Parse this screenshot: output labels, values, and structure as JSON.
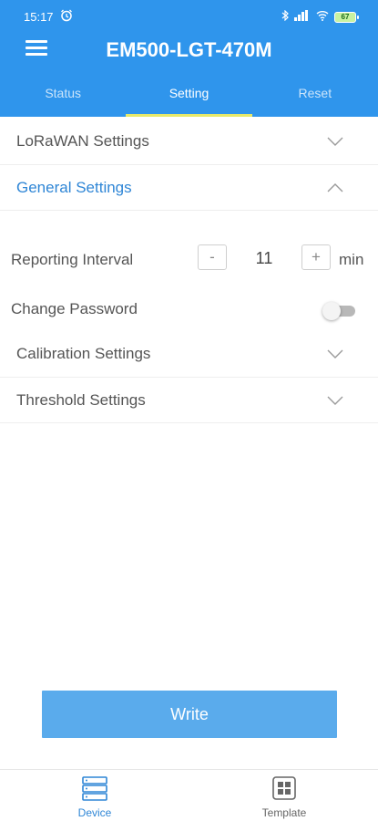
{
  "status_bar": {
    "time": "15:17",
    "alarm_icon": "alarm-clock-icon",
    "bluetooth_icon": "bluetooth-icon",
    "signal_icon": "cell-signal-icon",
    "wifi_icon": "wifi-icon",
    "battery": "67"
  },
  "header": {
    "menu_icon": "hamburger-menu-icon",
    "title": "EM500-LGT-470M",
    "bg_color": "#2f95ec"
  },
  "tabs": [
    {
      "label": "Status",
      "active": false
    },
    {
      "label": "Setting",
      "active": true
    },
    {
      "label": "Reset",
      "active": false
    }
  ],
  "sections": {
    "lorawan": {
      "label": "LoRaWAN Settings",
      "expanded": false
    },
    "general": {
      "label": "General Settings",
      "expanded": true
    },
    "calibration": {
      "label": "Calibration Settings",
      "expanded": false
    },
    "threshold": {
      "label": "Threshold Settings",
      "expanded": false
    }
  },
  "general_settings": {
    "reporting_interval": {
      "label": "Reporting Interval",
      "decrement": "-",
      "value": "11",
      "increment": "+",
      "unit": "min"
    },
    "change_password": {
      "label": "Change Password",
      "enabled": false
    }
  },
  "write_button": {
    "label": "Write"
  },
  "bottom_nav": [
    {
      "label": "Device",
      "icon": "device-list-icon",
      "active": true
    },
    {
      "label": "Template",
      "icon": "template-grid-icon",
      "active": false
    }
  ],
  "colors": {
    "accent": "#2f95ec",
    "active_text": "#2f86d6",
    "tab_indicator": "#e7e96a",
    "write_button": "#5aabec"
  }
}
